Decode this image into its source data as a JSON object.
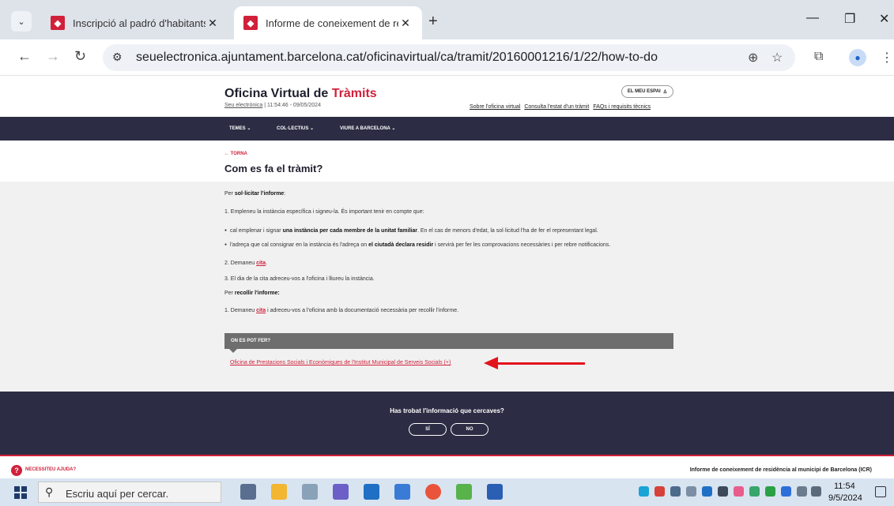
{
  "browser": {
    "tabs": [
      {
        "title": "Inscripció al padró d'habitants de l'Aju",
        "active": false
      },
      {
        "title": "Informe de coneixement de residència",
        "active": true
      }
    ],
    "url": "seuelectronica.ajuntament.barcelona.cat/oficinavirtual/ca/tramit/20160001216/1/22/how-to-do"
  },
  "header": {
    "brand_prefix": "Oficina Virtual de ",
    "brand_accent": "Tràmits",
    "seu_link": "Seu electrònica",
    "datetime": " | 11:54:46 - 09/05/2024",
    "meu_espai": "EL MEU ESPAI",
    "links": [
      "Sobre l'oficina virtual",
      "Consulta l'estat d'un tràmit",
      "FAQs i requisits tècnics"
    ]
  },
  "nav": {
    "items": [
      "TEMES",
      "COL·LECTIUS",
      "VIURE A BARCELONA"
    ]
  },
  "title_area": {
    "back": "TORNA",
    "title": "Com es fa el tràmit?"
  },
  "content": {
    "p1_prefix": "Per ",
    "p1_bold": "sol·licitar l'informe",
    "p1_suffix": ":",
    "step1": "1. Empleneu la instància específica i signeu-la. És important tenir en compte que:",
    "b1_a": "cal emplenar i signar ",
    "b1_bold": "una instància per cada membre de la unitat familiar",
    "b1_b": ". En el cas de menors d'edat, la sol·licitud l'ha de fer el representant legal.",
    "b2_a": "l'adreça que cal consignar en la instància és l'adreça on ",
    "b2_bold": "el ciutadà declara residir",
    "b2_b": " i servirà per fer les comprovacions necessàries i per rebre notificacions.",
    "step2_a": "2. Demaneu ",
    "step2_link": "cita",
    "step2_b": ".",
    "step3": "3. El dia de la cita adreceu-vos a l'oficina i lliureu la instància.",
    "p2_prefix": "Per ",
    "p2_bold": "recollir l'informe:",
    "collect_a": "1. Demaneu ",
    "collect_link": "cita",
    "collect_b": " i adreceu-vos a l'oficina amb la documentació necessària per recollir l'informe.",
    "where_label": "ON ES POT FER?",
    "office_link": "Oficina de Prestacions Socials i Econòmiques de l'Institut Municipal de Serveis Socials (+)"
  },
  "feedback": {
    "question": "Has trobat l'informació que cercaves?",
    "yes": "SÍ",
    "no": "NO"
  },
  "footer": {
    "help": "NECESSITEU AJUDA?",
    "right": "Informe de coneixement de residència al municipi de Barcelona (ICR)"
  },
  "taskbar": {
    "search_placeholder": "Escriu aquí per cercar.",
    "time": "11:54",
    "date": "9/5/2024"
  },
  "colors": {
    "accent": "#d1203a",
    "navy": "#2c2c44",
    "arrow": "#e3131b"
  }
}
